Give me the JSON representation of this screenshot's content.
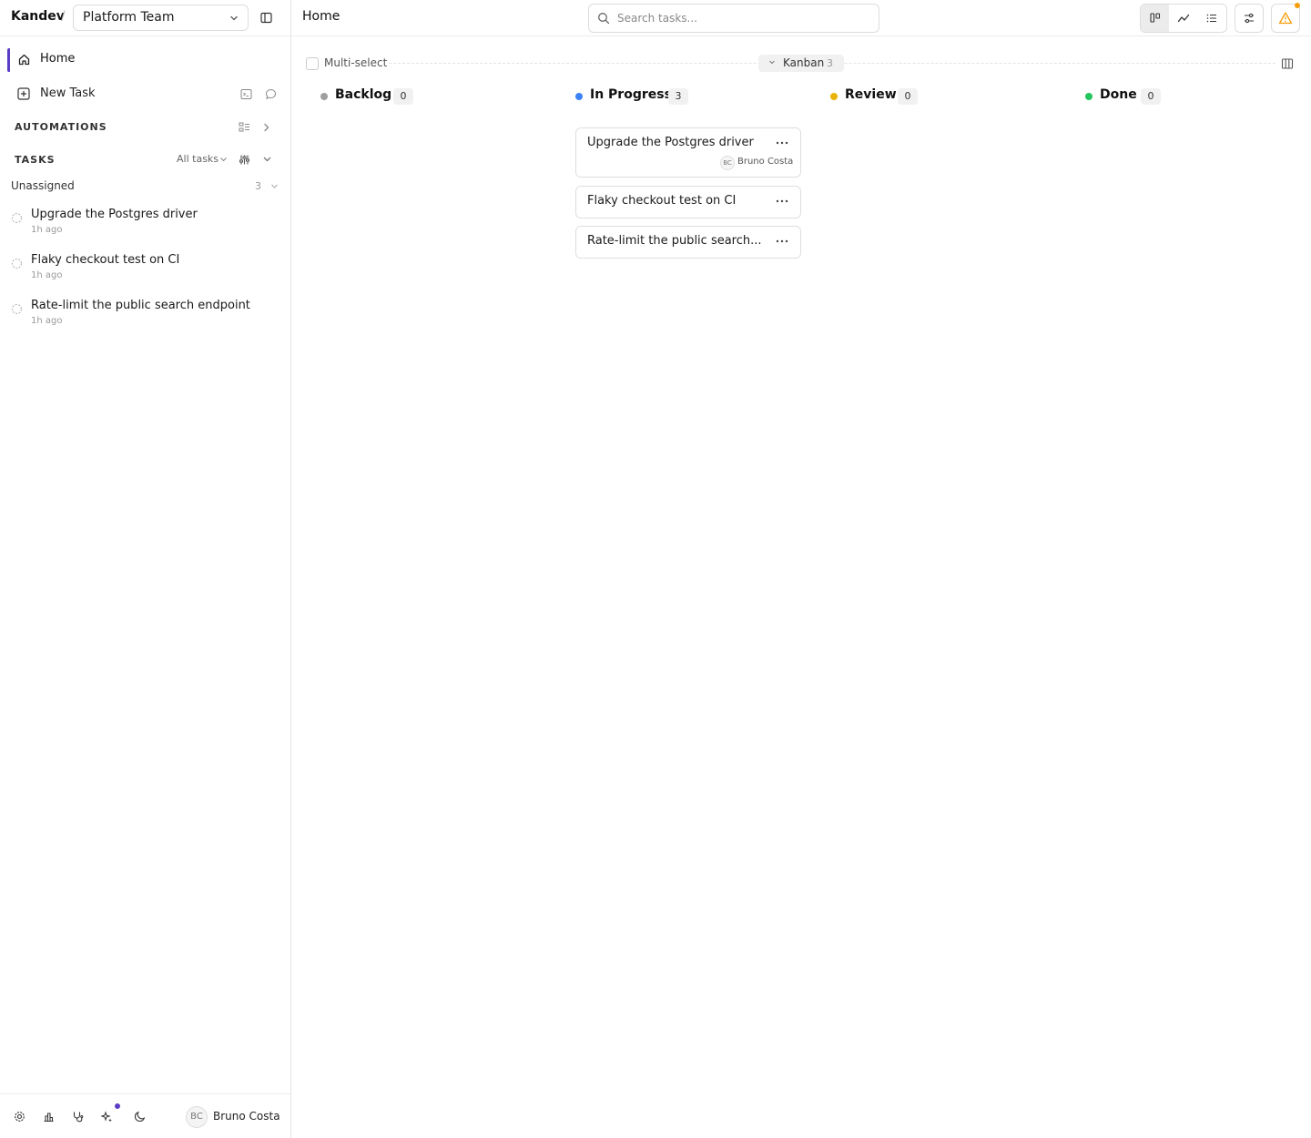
{
  "app": {
    "brand": "Kandev",
    "separator": "/",
    "workspace": "Platform Team"
  },
  "sidebar": {
    "nav": {
      "home": "Home",
      "new_task": "New Task"
    },
    "automations_title": "AUTOMATIONS",
    "tasks_title": "TASKS",
    "tasks_filter": "All tasks",
    "group": {
      "title": "Unassigned",
      "count": "3"
    },
    "tasks": [
      {
        "title": "Upgrade the Postgres driver",
        "time": "1h ago"
      },
      {
        "title": "Flaky checkout test on CI",
        "time": "1h ago"
      },
      {
        "title": "Rate-limit the public search endpoint",
        "time": "1h ago"
      }
    ],
    "user": {
      "initials": "BC",
      "name": "Bruno Costa"
    }
  },
  "header": {
    "title": "Home",
    "search_placeholder": "Search tasks..."
  },
  "board": {
    "multiselect_label": "Multi-select",
    "view_label": "Kanban",
    "view_count": "3",
    "columns": [
      {
        "name": "Backlog",
        "count": "0",
        "color": "#9e9e9e"
      },
      {
        "name": "In Progress",
        "count": "3",
        "color": "#3b82f6"
      },
      {
        "name": "Review",
        "count": "0",
        "color": "#eab308"
      },
      {
        "name": "Done",
        "count": "0",
        "color": "#22c55e"
      }
    ],
    "cards": [
      {
        "title": "Upgrade the Postgres driver",
        "assignee_initials": "BC",
        "assignee": "Bruno Costa"
      },
      {
        "title": "Flaky checkout test on CI"
      },
      {
        "title": "Rate-limit the public search..."
      }
    ]
  },
  "colors": {
    "accent": "#5b3cc4",
    "warning": "#f59e0b"
  }
}
